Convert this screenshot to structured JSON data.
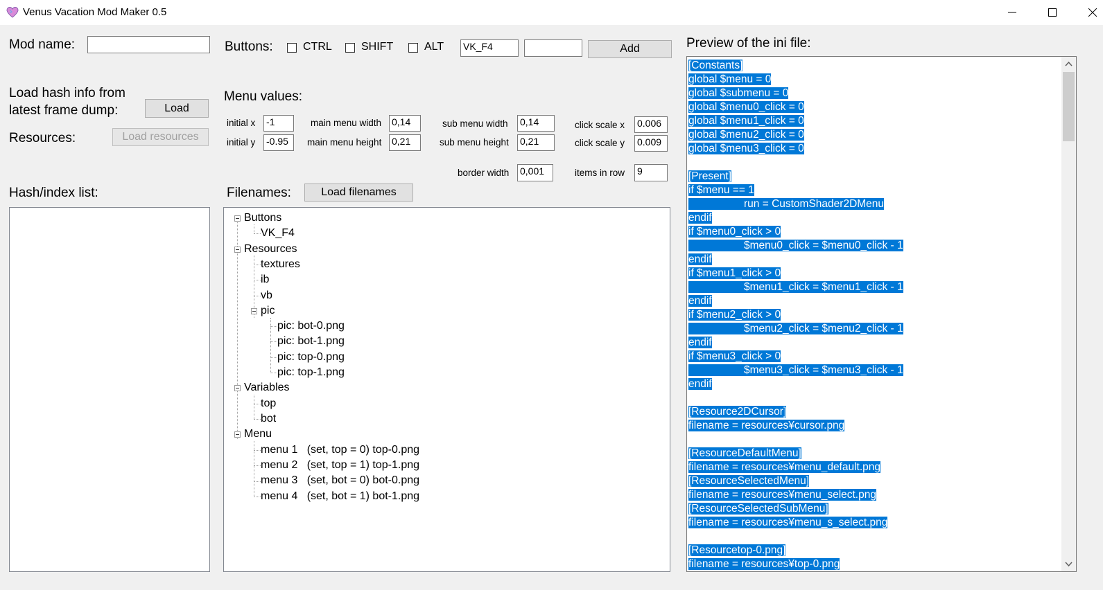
{
  "window": {
    "title": "Venus Vacation Mod Maker 0.5"
  },
  "mod_name": {
    "label": "Mod name:",
    "value": ""
  },
  "buttons_row": {
    "label": "Buttons:",
    "ctrl": "CTRL",
    "shift": "SHIFT",
    "alt": "ALT",
    "key_value": "VK_F4",
    "extra_value": "",
    "add_label": "Add"
  },
  "load_hash": {
    "label_line1": "Load hash info from",
    "label_line2": "latest frame dump:",
    "button": "Load"
  },
  "resources": {
    "label": "Resources:",
    "button": "Load resources"
  },
  "menu_values": {
    "title": "Menu values:",
    "initial_x_label": "initial x",
    "initial_x": "-1",
    "initial_y_label": "initial y",
    "initial_y": "-0.95",
    "main_menu_width_label": "main menu width",
    "main_menu_width": "0,14",
    "main_menu_height_label": "main menu height",
    "main_menu_height": "0,21",
    "sub_menu_width_label": "sub menu width",
    "sub_menu_width": "0,14",
    "sub_menu_height_label": "sub menu height",
    "sub_menu_height": "0,21",
    "click_scale_x_label": "click scale x",
    "click_scale_x": "0.006",
    "click_scale_y_label": "click scale y",
    "click_scale_y": "0.009",
    "border_width_label": "border width",
    "border_width": "0,001",
    "items_in_row_label": "items in row",
    "items_in_row": "9"
  },
  "hash_list": {
    "label": "Hash/index list:"
  },
  "filenames": {
    "label": "Filenames:",
    "button": "Load filenames"
  },
  "tree": {
    "buttons": "Buttons",
    "vk_f4": "VK_F4",
    "resources": "Resources",
    "textures": "textures",
    "ib": "ib",
    "vb": "vb",
    "pic": "pic",
    "pic_bot0": "pic: bot-0.png",
    "pic_bot1": "pic: bot-1.png",
    "pic_top0": "pic: top-0.png",
    "pic_top1": "pic: top-1.png",
    "variables": "Variables",
    "var_top": "top",
    "var_bot": "bot",
    "menu": "Menu",
    "menu1": "menu 1   (set, top = 0) top-0.png",
    "menu2": "menu 2   (set, top = 1) top-1.png",
    "menu3": "menu 3   (set, bot = 0) bot-0.png",
    "menu4": "menu 4   (set, bot = 1) bot-1.png"
  },
  "preview": {
    "label": "Preview of the ini file:",
    "l01": "[Constants]",
    "l02": "global $menu = 0",
    "l03": "global $submenu = 0",
    "l04": "global $menu0_click = 0",
    "l05": "global $menu1_click = 0",
    "l06": "global $menu2_click = 0",
    "l07": "global $menu3_click = 0",
    "l08": "[Present]",
    "l09": "if $menu == 1",
    "l10": "run = CustomShader2DMenu",
    "l11": "endif",
    "l12": "if $menu0_click > 0",
    "l13": "$menu0_click = $menu0_click - 1",
    "l14": "endif",
    "l15": "if $menu1_click > 0",
    "l16": "$menu1_click = $menu1_click - 1",
    "l17": "endif",
    "l18": "if $menu2_click > 0",
    "l19": "$menu2_click = $menu2_click - 1",
    "l20": "endif",
    "l21": "if $menu3_click > 0",
    "l22": "$menu3_click = $menu3_click - 1",
    "l23": "endif",
    "l24": "[Resource2DCursor]",
    "l25": "filename = resources¥cursor.png",
    "l26": "[ResourceDefaultMenu]",
    "l27": "filename = resources¥menu_default.png",
    "l28": "[ResourceSelectedMenu]",
    "l29": "filename = resources¥menu_select.png",
    "l30": "[ResourceSelectedSubMenu]",
    "l31": "filename = resources¥menu_s_select.png",
    "l32": "[Resourcetop-0.png]",
    "l33": "filename = resources¥top-0.png"
  },
  "colors": {
    "selection": "#0078d7",
    "background": "#f0f0f0"
  }
}
